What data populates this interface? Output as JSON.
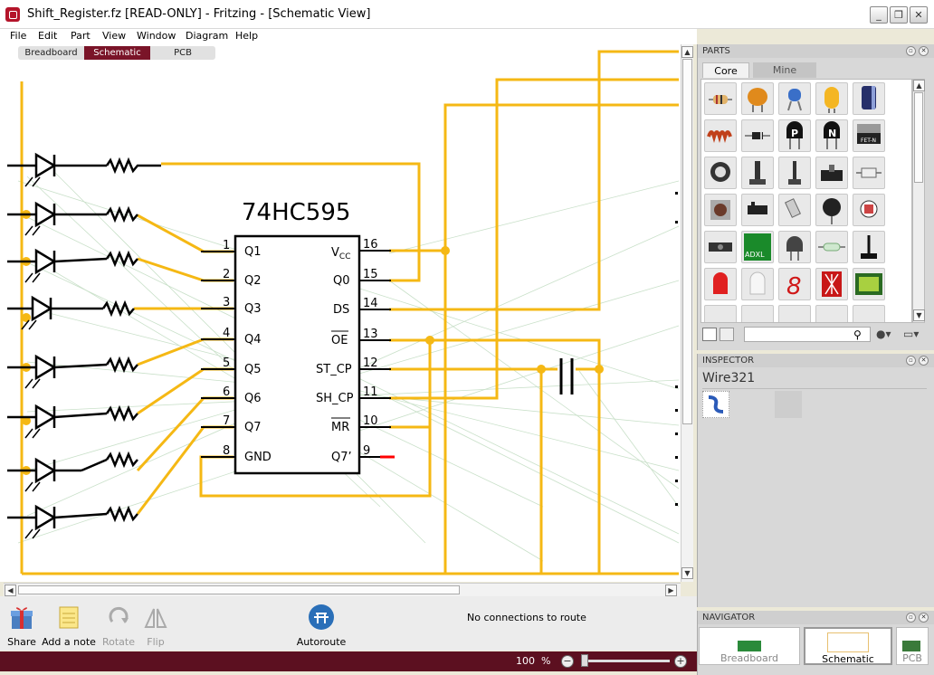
{
  "window": {
    "title": "Shift_Register.fz [READ-ONLY]  - Fritzing - [Schematic View]",
    "controls": [
      "_",
      "❒",
      "✕"
    ]
  },
  "menu": [
    "File",
    "Edit",
    "Part",
    "View",
    "Window",
    "Diagram",
    "Help"
  ],
  "view_tabs": [
    {
      "label": "Breadboard",
      "active": false
    },
    {
      "label": "Schematic",
      "active": true
    },
    {
      "label": "PCB",
      "active": false
    }
  ],
  "schematic": {
    "chip_name": "74HC595",
    "left_pins": [
      {
        "num": "1",
        "name": "Q1"
      },
      {
        "num": "2",
        "name": "Q2"
      },
      {
        "num": "3",
        "name": "Q3"
      },
      {
        "num": "4",
        "name": "Q4"
      },
      {
        "num": "5",
        "name": "Q5"
      },
      {
        "num": "6",
        "name": "Q6"
      },
      {
        "num": "7",
        "name": "Q7"
      },
      {
        "num": "8",
        "name": "GND"
      }
    ],
    "right_pins": [
      {
        "num": "16",
        "name": "V",
        "sub": "CC"
      },
      {
        "num": "15",
        "name": "Q0"
      },
      {
        "num": "14",
        "name": "DS"
      },
      {
        "num": "13",
        "name": "OE",
        "overline": true
      },
      {
        "num": "12",
        "name": "ST_CP"
      },
      {
        "num": "11",
        "name": "SH_CP"
      },
      {
        "num": "10",
        "name": "MR",
        "overline": true
      },
      {
        "num": "9",
        "name": "Q7’"
      }
    ],
    "wire_color": "#f5b814",
    "trace_color": "#ff0000"
  },
  "toolbar": {
    "items": [
      {
        "label": "Share",
        "icon": "gift-icon",
        "enabled": true
      },
      {
        "label": "Add a note",
        "icon": "note-icon",
        "enabled": true
      },
      {
        "label": "Rotate",
        "icon": "rotate-icon",
        "enabled": false
      },
      {
        "label": "Flip",
        "icon": "flip-icon",
        "enabled": false
      },
      {
        "label": "Autoroute",
        "icon": "autoroute-icon",
        "enabled": true
      }
    ],
    "status": "No connections to route"
  },
  "zoom": {
    "value": "100",
    "unit": "%",
    "minus": "−",
    "plus": "+"
  },
  "parts": {
    "title": "PARTS",
    "tabs": [
      {
        "label": "Core",
        "active": true
      },
      {
        "label": "Mine",
        "active": false
      }
    ],
    "part_icons": [
      "resistor-icon",
      "ceramic-capacitor-icon",
      "capacitor-blue-icon",
      "tantalum-capacitor-icon",
      "electrolytic-capacitor-icon",
      "inductor-icon",
      "diode-icon",
      "pnp-transistor-icon",
      "npn-transistor-icon",
      "fet-icon",
      "potentiometer-icon",
      "slide-pot-icon",
      "trimmer-icon",
      "switch-icon",
      "fuse-icon",
      "pushbutton-icon",
      "relay-icon",
      "tilt-sensor-icon",
      "photocell-icon",
      "flex-sensor-icon",
      "ir-sensor-icon",
      "accelerometer-icon",
      "temperature-sensor-icon",
      "reed-switch-icon",
      "antenna-icon",
      "red-led-icon",
      "white-led-icon",
      "seven-segment-icon",
      "starburst-display-icon",
      "lcd-icon"
    ],
    "accelerometer_label": "ADXL",
    "seg_digit": "8",
    "fet_label": "FET-N",
    "pnp_label": "P",
    "npn_label": "N"
  },
  "inspector": {
    "title": "INSPECTOR",
    "selected": "Wire321"
  },
  "navigator": {
    "title": "NAVIGATOR",
    "views": [
      {
        "label": "Breadboard"
      },
      {
        "label": "Schematic"
      },
      {
        "label": "PCB"
      }
    ]
  }
}
